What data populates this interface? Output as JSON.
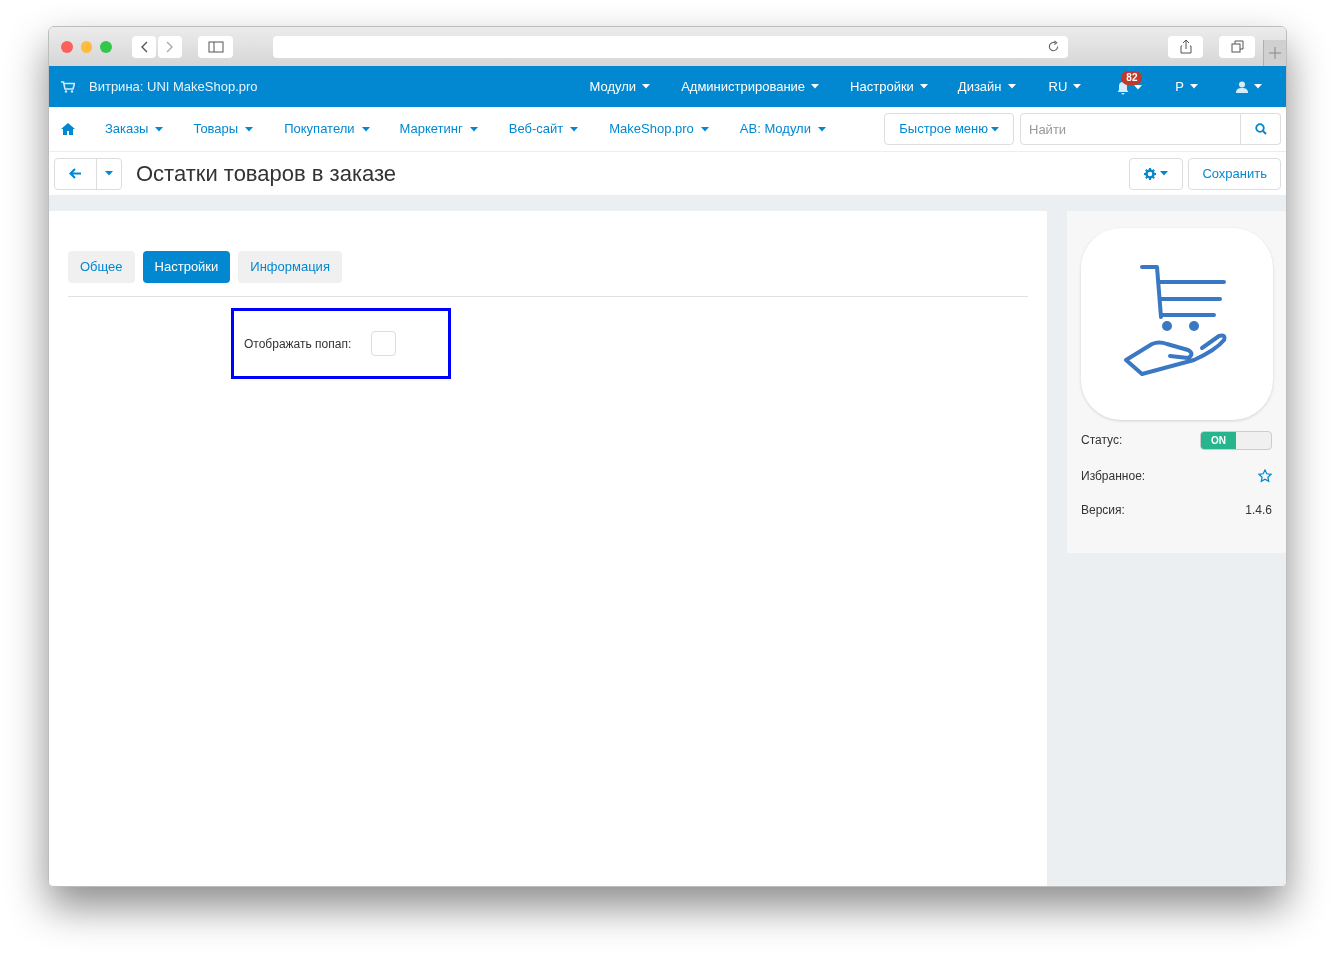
{
  "topbar": {
    "store": "Витрина: UNI MakeShop.pro",
    "menus": [
      {
        "label": "Модули"
      },
      {
        "label": "Администрирование"
      },
      {
        "label": "Настройки"
      },
      {
        "label": "Дизайн"
      },
      {
        "label": "RU"
      }
    ],
    "notifications": {
      "count": "82"
    },
    "currency": "Р"
  },
  "nav": {
    "items": [
      {
        "label": "Заказы"
      },
      {
        "label": "Товары"
      },
      {
        "label": "Покупатели"
      },
      {
        "label": "Маркетинг"
      },
      {
        "label": "Веб-сайт"
      },
      {
        "label": "MakeShop.pro"
      },
      {
        "label": "AB: Модули"
      }
    ],
    "quick_menu": "Быстрое меню",
    "search": {
      "placeholder": "Найти"
    }
  },
  "page": {
    "title": "Остатки товаров в заказе",
    "save": "Сохранить"
  },
  "tabs": [
    {
      "label": "Общее",
      "selected": false
    },
    {
      "label": "Настройки",
      "selected": true
    },
    {
      "label": "Информация",
      "selected": false
    }
  ],
  "settings": [
    {
      "label": "Отображать попап:",
      "checked": false,
      "highlighted": true
    }
  ],
  "module": {
    "status": {
      "label": "Статус:",
      "text": "ON",
      "on": true
    },
    "favorite": {
      "label": "Избранное:",
      "starred": false
    },
    "version": {
      "label": "Версия:",
      "value": "1.4.6"
    }
  }
}
